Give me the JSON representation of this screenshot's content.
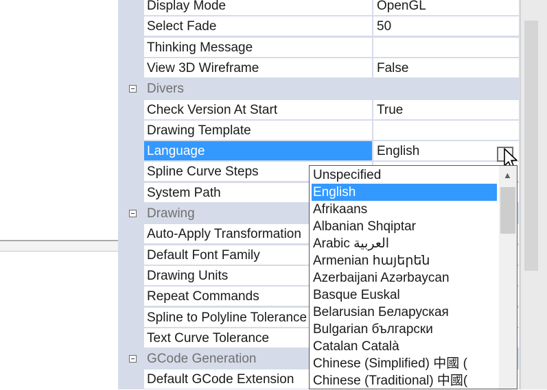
{
  "properties": [
    {
      "type": "row",
      "name": "Display Mode",
      "value": "OpenGL"
    },
    {
      "type": "row",
      "name": "Select Fade",
      "value": "50"
    },
    {
      "type": "row",
      "name": "Thinking Message",
      "value": ""
    },
    {
      "type": "row",
      "name": "View 3D Wireframe",
      "value": "False"
    },
    {
      "type": "category",
      "name": "Divers"
    },
    {
      "type": "row",
      "name": "Check Version At Start",
      "value": "True"
    },
    {
      "type": "row",
      "name": "Drawing Template",
      "value": ""
    },
    {
      "type": "row",
      "name": "Language",
      "value": "English",
      "selected": true
    },
    {
      "type": "row",
      "name": "Spline Curve Steps",
      "value": ""
    },
    {
      "type": "row",
      "name": "System Path",
      "value": ""
    },
    {
      "type": "category",
      "name": "Drawing"
    },
    {
      "type": "row",
      "name": "Auto-Apply Transformation",
      "value": ""
    },
    {
      "type": "row",
      "name": "Default Font Family",
      "value": ""
    },
    {
      "type": "row",
      "name": "Drawing Units",
      "value": ""
    },
    {
      "type": "row",
      "name": "Repeat Commands",
      "value": ""
    },
    {
      "type": "row",
      "name": "Spline to Polyline Tolerance",
      "value": ""
    },
    {
      "type": "row",
      "name": "Text Curve Tolerance",
      "value": ""
    },
    {
      "type": "category",
      "name": "GCode Generation"
    },
    {
      "type": "row",
      "name": "Default GCode Extension",
      "value": ""
    }
  ],
  "dropdown": {
    "selected": "English",
    "options": [
      "Unspecified",
      "English",
      "Afrikaans",
      "Albanian Shqiptar",
      "Arabic العربية",
      "Armenian հայերեն",
      "Azerbaijani Azərbaycan",
      "Basque Euskal",
      "Belarusian Беларуская",
      "Bulgarian български",
      "Catalan Català",
      "Chinese (Simplified) 中國 (",
      "Chinese (Traditional) 中國("
    ]
  },
  "colors": {
    "selection": "#3399ff",
    "category_bg": "#d6dbe9",
    "category_text": "#707070"
  },
  "icons": {
    "category_toggle": "minus-box-icon",
    "dropdown_button": "dropdown-arrow-button",
    "cursor": "mouse-pointer-icon"
  }
}
